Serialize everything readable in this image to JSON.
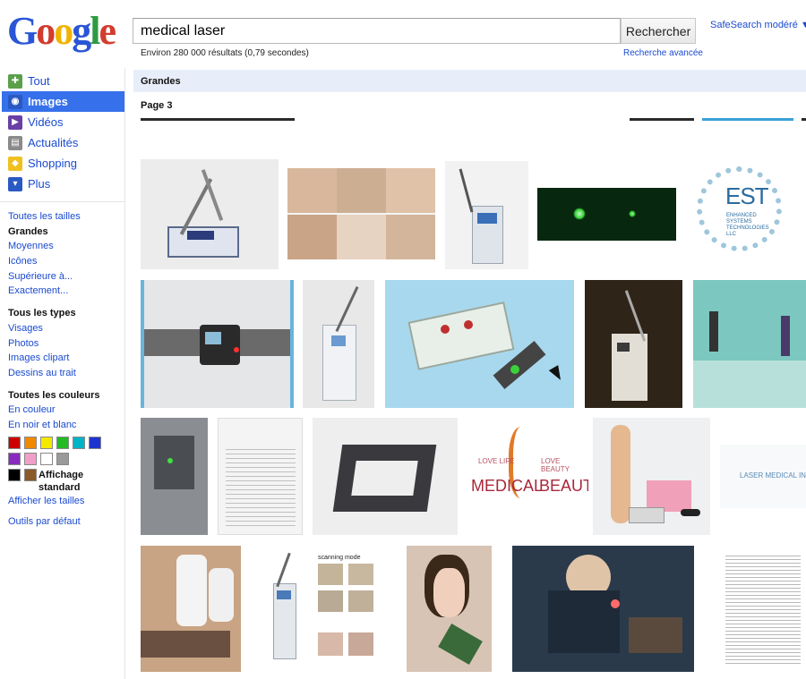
{
  "logo": {
    "letters": [
      "G",
      "o",
      "o",
      "g",
      "l",
      "e"
    ],
    "colors": [
      "#2a55d6",
      "#d23c2e",
      "#f0b400",
      "#2a55d6",
      "#2e9a43",
      "#d23c2e"
    ]
  },
  "search": {
    "query": "medical laser",
    "button": "Rechercher"
  },
  "safesearch": "SafeSearch modéré ▼",
  "results_count": "Environ 280 000 résultats (0,79 secondes)",
  "advanced_search": "Recherche avancée",
  "nav": [
    {
      "label": "Tout",
      "icon": "all-icon",
      "color": "#5aa04a"
    },
    {
      "label": "Images",
      "icon": "images-icon",
      "color": "#2b59c3",
      "active": true
    },
    {
      "label": "Vidéos",
      "icon": "videos-icon",
      "color": "#6a3fa6"
    },
    {
      "label": "Actualités",
      "icon": "news-icon",
      "color": "#8a8a8a"
    },
    {
      "label": "Shopping",
      "icon": "shopping-icon",
      "color": "#f0c020"
    },
    {
      "label": "Plus",
      "icon": "more-icon",
      "color": "#2b59c3"
    }
  ],
  "filters": {
    "size": [
      "Toutes les tailles",
      "Grandes",
      "Moyennes",
      "Icônes",
      "Supérieure à...",
      "Exactement..."
    ],
    "size_selected": "Grandes",
    "type_title": "Tous les types",
    "type": [
      "Visages",
      "Photos",
      "Images clipart",
      "Dessins au trait"
    ],
    "color_title": "Toutes les couleurs",
    "color": [
      "En couleur",
      "En noir et blanc"
    ],
    "swatches": [
      "#cc0000",
      "#f08a00",
      "#f5e900",
      "#22bb22",
      "#00b4c8",
      "#1e34d0",
      "#8a2bc0",
      "#f0a0c8",
      "#ffffff",
      "#9a9a9a",
      "#000000",
      "#8a5a2a"
    ],
    "affichage": "Affichage standard",
    "show_sizes": "Afficher les tailles",
    "default_tools": "Outils par défaut"
  },
  "band_label": "Grandes",
  "page_label": "Page 3",
  "image_texts": {
    "est": "EST",
    "est_sub": "ENHANCED SYSTEMS TECHNOLOGIES LLC",
    "love_left": "LOVE LIFE",
    "love_right": "LOVE BEAUTY",
    "medical": "MEDICAL",
    "beauty": "BEAUTY",
    "laser_medical": "LASER MEDICAL INST",
    "scanning": "scanning mode"
  }
}
